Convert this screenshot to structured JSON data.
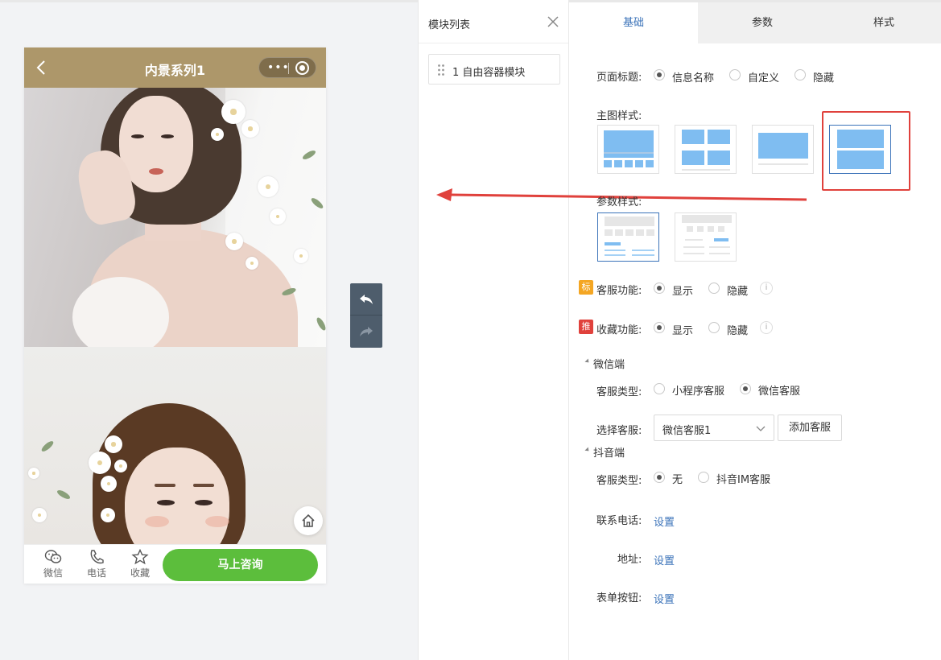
{
  "phone": {
    "title": "内景系列1",
    "tabs": [
      {
        "label": "微信",
        "icon": "wechat-icon"
      },
      {
        "label": "电话",
        "icon": "phone-icon"
      },
      {
        "label": "收藏",
        "icon": "star-icon"
      }
    ],
    "consult_button": "马上咨询"
  },
  "module_panel": {
    "title": "模块列表",
    "items": [
      {
        "label": "1 自由容器模块"
      }
    ]
  },
  "settings": {
    "tabs": [
      {
        "label": "基础",
        "active": true
      },
      {
        "label": "参数",
        "active": false
      },
      {
        "label": "样式",
        "active": false
      }
    ],
    "page_title": {
      "label": "页面标题:",
      "options": [
        "信息名称",
        "自定义",
        "隐藏"
      ],
      "selected": "信息名称"
    },
    "main_image_style": {
      "label": "主图样式:",
      "selected_index": 3
    },
    "param_style": {
      "label": "参数样式:",
      "selected_index": 0
    },
    "customer_service": {
      "tag": "标",
      "label": "客服功能:",
      "options": [
        "显示",
        "隐藏"
      ],
      "selected": "显示"
    },
    "favorite": {
      "tag": "推",
      "label": "收藏功能:",
      "options": [
        "显示",
        "隐藏"
      ],
      "selected": "显示"
    },
    "wechat_section": {
      "title": "微信端",
      "cs_type_label": "客服类型:",
      "cs_type_options": [
        "小程序客服",
        "微信客服"
      ],
      "cs_type_selected": "微信客服",
      "select_cs_label": "选择客服:",
      "select_cs_value": "微信客服1",
      "add_button": "添加客服"
    },
    "douyin_section": {
      "title": "抖音端",
      "cs_type_label": "客服类型:",
      "cs_type_options": [
        "无",
        "抖音IM客服"
      ],
      "cs_type_selected": "无"
    },
    "phone_row": {
      "label": "联系电话:",
      "link": "设置"
    },
    "address_row": {
      "label": "地址:",
      "link": "设置"
    },
    "form_button_row": {
      "label": "表单按钮:",
      "link": "设置"
    }
  },
  "colors": {
    "nav_bg": "#ad976a",
    "consult_green": "#5cbe3c",
    "accent_blue": "#3b73b9",
    "annotation_red": "#e0413c",
    "tag_orange": "#f4a623",
    "tag_red": "#e0413c"
  }
}
